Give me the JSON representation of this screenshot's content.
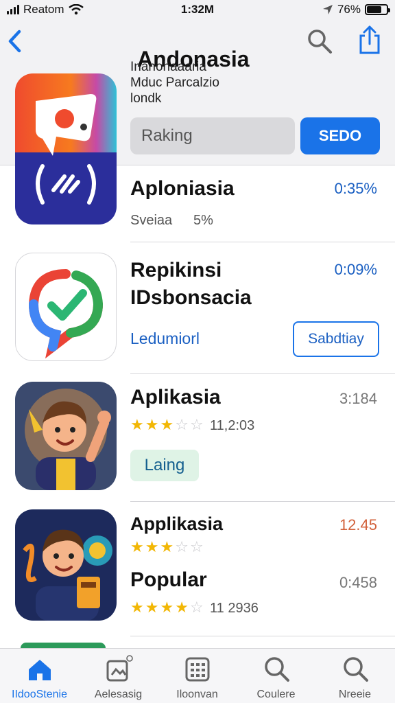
{
  "status_bar": {
    "carrier": "Reatom",
    "time": "1:32M",
    "battery": "76%",
    "battery_level": 0.76
  },
  "header": {
    "title": "Andonasia",
    "subtitle_lines": [
      "Inanohaaaria",
      "Mduc Parcalzio",
      "londk"
    ],
    "search_value": "Raking",
    "primary_button": "SEDO"
  },
  "rows": [
    {
      "title": "Aploniasia",
      "value": "0:35%",
      "meta_left": "Sveiaa",
      "meta_right": "5%"
    },
    {
      "title_line1": "Repikinsi",
      "title_line2": "IDsbonsacia",
      "value": "0:09%",
      "link": "Ledumiorl",
      "button": "Sabdtiay"
    },
    {
      "title": "Aplikasia",
      "value": "3:184",
      "rating": 3,
      "rating_count": "11,2:03",
      "button": "Laing"
    },
    {
      "title": "Applikasia",
      "value": "12.45",
      "rating": 2.5,
      "title2": "Popular",
      "value2": "0:458",
      "rating2": 4,
      "rating_count2": "11 2936"
    }
  ],
  "tabs": [
    {
      "label": "IIdooStenie",
      "icon": "home-icon",
      "active": true
    },
    {
      "label": "Aelesasig",
      "icon": "media-icon",
      "active": false
    },
    {
      "label": "Iloonvan",
      "icon": "grid-icon",
      "active": false
    },
    {
      "label": "Coulere",
      "icon": "search-icon",
      "active": false
    },
    {
      "label": "Nreeie",
      "icon": "search-icon",
      "active": false
    }
  ],
  "colors": {
    "accent": "#1a73e8",
    "star": "#f2b705",
    "orange_value": "#d2623c"
  }
}
